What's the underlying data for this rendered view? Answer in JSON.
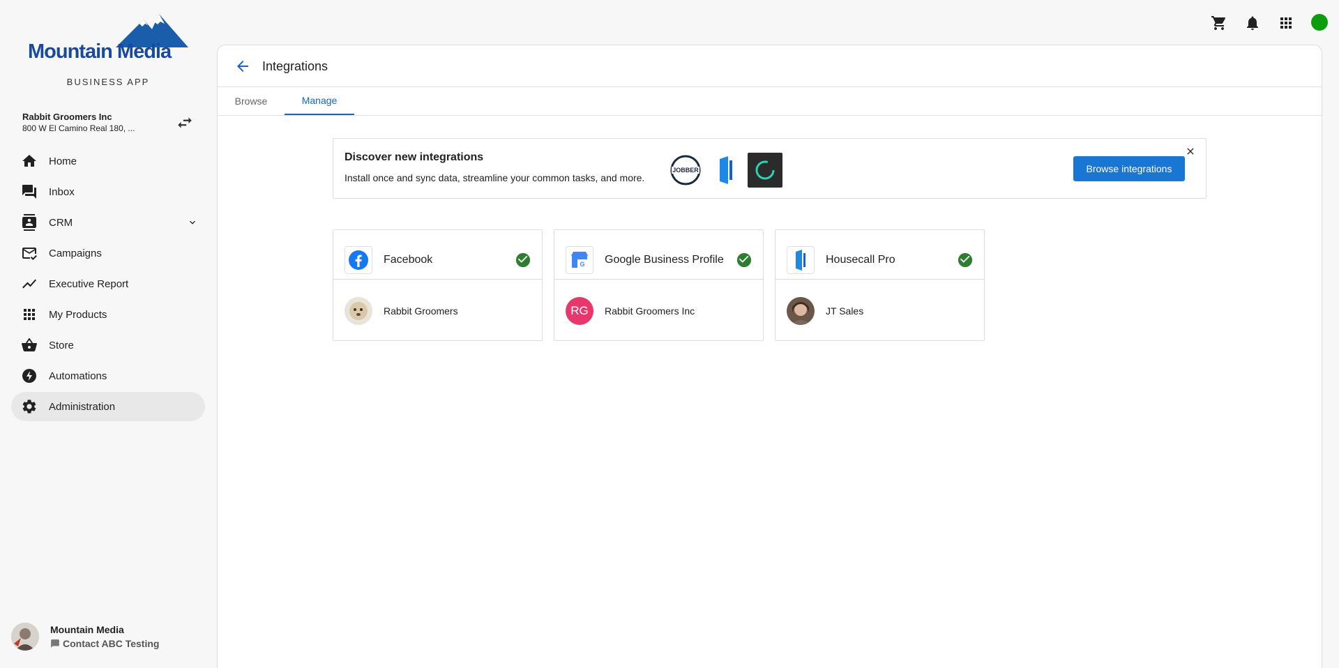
{
  "brand": {
    "logo_text": "Mountain Media",
    "app_label": "BUSINESS APP"
  },
  "account": {
    "name": "Rabbit Groomers Inc",
    "address": "800 W El Camino Real 180, ..."
  },
  "nav": [
    {
      "label": "Home",
      "icon": "home-icon"
    },
    {
      "label": "Inbox",
      "icon": "inbox-icon"
    },
    {
      "label": "CRM",
      "icon": "contacts-icon"
    },
    {
      "label": "Campaigns",
      "icon": "campaigns-icon"
    },
    {
      "label": "Executive Report",
      "icon": "trending-icon"
    },
    {
      "label": "My Products",
      "icon": "grid-icon"
    },
    {
      "label": "Store",
      "icon": "basket-icon"
    },
    {
      "label": "Automations",
      "icon": "bolt-icon"
    },
    {
      "label": "Administration",
      "icon": "gear-icon",
      "active": true
    }
  ],
  "user": {
    "name": "Mountain Media",
    "contact": "Contact ABC Testing"
  },
  "topbar": {
    "icons": [
      "cart-icon",
      "bell-icon",
      "apps-icon"
    ],
    "status_color": "#0b9d0b"
  },
  "page": {
    "title": "Integrations",
    "tabs": [
      {
        "label": "Browse",
        "active": false
      },
      {
        "label": "Manage",
        "active": true
      }
    ]
  },
  "banner": {
    "title": "Discover new integrations",
    "description": "Install once and sync data, streamline your common tasks, and more.",
    "logo_text": "JOBBER",
    "button": "Browse integrations"
  },
  "integrations": [
    {
      "name": "Facebook",
      "account": "Rabbit Groomers",
      "icon": "facebook-icon",
      "connected": true
    },
    {
      "name": "Google Business Profile",
      "account": "Rabbit Groomers Inc",
      "account_initials": "RG",
      "icon": "google-business-icon",
      "connected": true
    },
    {
      "name": "Housecall Pro",
      "account": "JT Sales",
      "icon": "housecall-pro-icon",
      "connected": true
    }
  ],
  "colors": {
    "accent": "#1565c0",
    "button": "#1976d2",
    "check": "#2e7d32",
    "rg_avatar": "#e8386b"
  }
}
